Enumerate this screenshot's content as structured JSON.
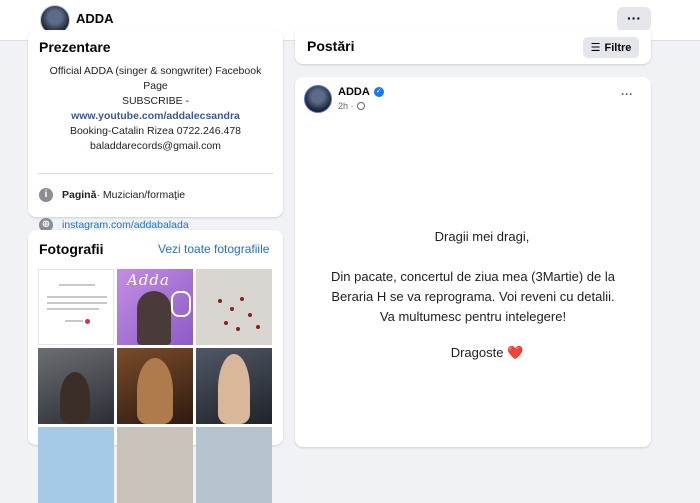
{
  "header": {
    "page_name": "ADDA",
    "more_label": "···"
  },
  "intro": {
    "title": "Prezentare",
    "bio_lines": [
      "Official ADDA (singer & songwriter) Facebook",
      "Page"
    ],
    "subscribe_prefix": "SUBSCRIBE - ",
    "subscribe_link": "www.youtube.com/addalecsandra",
    "booking": "Booking-Catalin Rizea 0722.246.478",
    "email": "baladdarecords@gmail.com",
    "category_label": "Pagină",
    "category_value": " · Muzician/formaţie",
    "instagram": "instagram.com/addabalada"
  },
  "photos": {
    "title": "Fotografii",
    "see_all": "Vezi toate fotografiile",
    "tile2_word": "Adda"
  },
  "posts": {
    "title": "Postări",
    "filter_label": "Filtre"
  },
  "post": {
    "author": "ADDA",
    "time": "2h ·",
    "more_label": "···",
    "greeting": "Dragii mei dragi,",
    "body_lines": [
      "Din pacate, concertul de ziua mea (3Martie) de la",
      "Beraria H se va reprograma. Voi reveni cu detalii.",
      "Va multumesc pentru intelegere!"
    ],
    "signoff": "Dragoste",
    "signoff_emoji": "❤️"
  },
  "colors": {
    "link": "#216fdb",
    "verified": "#1877f2",
    "background": "#f0f2f5"
  }
}
